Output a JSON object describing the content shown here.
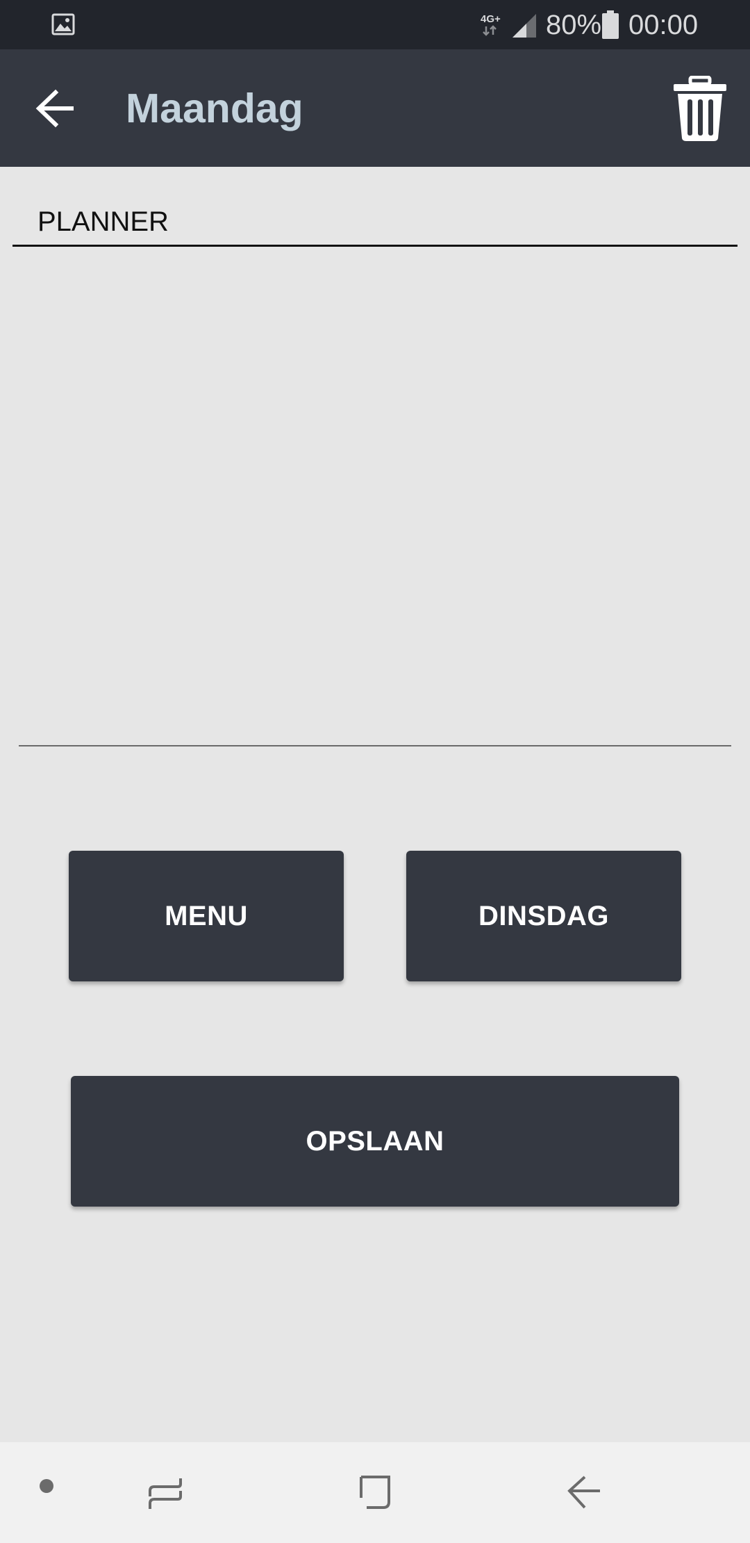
{
  "status_bar": {
    "network_type": "4G+",
    "battery_percent": "80%",
    "time": "00:00",
    "icons": [
      "gallery-icon",
      "network-icon",
      "signal-icon",
      "battery-icon"
    ]
  },
  "app_bar": {
    "title": "Maandag",
    "back_icon": "arrow-left-icon",
    "delete_icon": "trash-icon"
  },
  "form": {
    "planner_value": "PLANNER",
    "notes_value": ""
  },
  "buttons": {
    "menu": "MENU",
    "dinsdag": "DINSDAG",
    "opslaan": "OPSLAAN"
  },
  "nav_bar": {
    "icons": [
      "dot-icon",
      "recents-icon",
      "home-icon",
      "back-icon"
    ]
  },
  "colors": {
    "app_bar": "#343841",
    "status_bar": "#22252c",
    "background": "#e6e6e6",
    "title": "#c3d2dc",
    "button": "#343841",
    "button_text": "#ffffff"
  }
}
